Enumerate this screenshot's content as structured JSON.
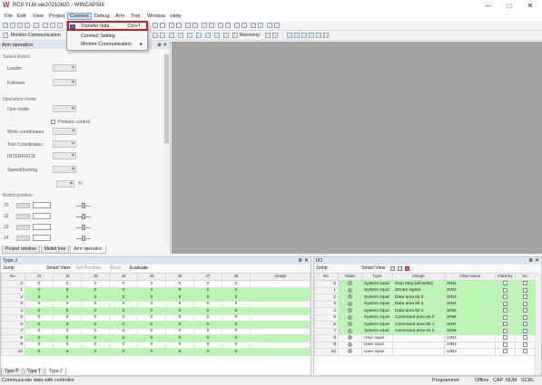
{
  "window": {
    "title": "RC9 YLM ver20210820 - WINCAPSIII",
    "min": "─",
    "max": "□",
    "close": "✕"
  },
  "menu": [
    "File",
    "Edit",
    "View",
    "Project",
    "Connect",
    "Debug",
    "Arm",
    "Tool",
    "Window",
    "Help"
  ],
  "toolbar2": {
    "monitor": "Monitor Communication",
    "recovery": "Recovery"
  },
  "connect_menu": {
    "items": [
      {
        "label": "Transfer data ...",
        "shortcut": "Ctrl+T"
      },
      {
        "label": "Connect Setting",
        "shortcut": ""
      },
      {
        "label": "Monitor Communication",
        "shortcut": ""
      }
    ],
    "submenu_arrow": "▸"
  },
  "arm_panel": {
    "title": "Arm operation",
    "pin": "⊕ ✕",
    "select_robot": "Select Robot",
    "leader": "Leader",
    "follower": "Follower",
    "operation_mode": "Operation mode",
    "ope_mode": "Ope mode",
    "posture_control": "Posture control",
    "work_coordinates": "Work coordinates",
    "tool_coordinates": "Tool Coordinates",
    "speed_label": "INTERP/ECE",
    "speed_inching": "Speed/Inching",
    "percent": "%",
    "robot_position": "Robot position",
    "joints": [
      "J1",
      "J2",
      "J3",
      "J4"
    ]
  },
  "left_tabs": [
    "Project window",
    "Model tree",
    "Arm operation"
  ],
  "typej": {
    "title": "Type J",
    "jump": "Jump",
    "smart_view": "Smart View",
    "get_position": "Get Position",
    "move": "Move",
    "evaluate": "Evaluate",
    "columns": [
      "No.",
      "J1",
      "J2",
      "J3",
      "J4",
      "J5",
      "J6",
      "J7",
      "J8",
      "Usage"
    ],
    "rows": [
      [
        "0",
        "0",
        "0",
        "0",
        "0",
        "0",
        "0",
        "0",
        "0",
        ""
      ],
      [
        "1",
        "0",
        "0",
        "0",
        "0",
        "0",
        "0",
        "0",
        "0",
        ""
      ],
      [
        "2",
        "0",
        "0",
        "0",
        "0",
        "0",
        "0",
        "0",
        "0",
        ""
      ],
      [
        "3",
        "0",
        "0",
        "0",
        "0",
        "0",
        "0",
        "0",
        "0",
        ""
      ],
      [
        "4",
        "0",
        "0",
        "0",
        "0",
        "0",
        "0",
        "0",
        "0",
        ""
      ],
      [
        "5",
        "0",
        "0",
        "0",
        "0",
        "0",
        "0",
        "0",
        "0",
        ""
      ],
      [
        "6",
        "0",
        "0",
        "0",
        "0",
        "0",
        "0",
        "0",
        "0",
        ""
      ],
      [
        "7",
        "0",
        "0",
        "0",
        "0",
        "0",
        "0",
        "0",
        "0",
        ""
      ],
      [
        "8",
        "0",
        "0",
        "0",
        "0",
        "0",
        "0",
        "0",
        "0",
        ""
      ],
      [
        "9",
        "0",
        "0",
        "0",
        "0",
        "0",
        "0",
        "0",
        "0",
        ""
      ],
      [
        "10",
        "0",
        "0",
        "0",
        "0",
        "0",
        "0",
        "0",
        "0",
        ""
      ]
    ],
    "tabs": [
      "Type P",
      "Type T",
      "Type J"
    ]
  },
  "io": {
    "title": "I/O",
    "jump": "Jump",
    "smart_view": "Smart View",
    "columns": [
      "No.",
      "State",
      "Type",
      "Usage",
      "Alias name",
      "Dummy",
      "Inv"
    ],
    "rows": [
      [
        "0",
        "System input",
        "Stop stop (all tasks)",
        "SIN1"
      ],
      [
        "1",
        "System input",
        "Strobe signal",
        "SIN2"
      ],
      [
        "2",
        "System input",
        "Data area bit 0",
        "SIN3"
      ],
      [
        "3",
        "System input",
        "Data area bit 1",
        "SIN4"
      ],
      [
        "4",
        "System input",
        "Data area bit 2",
        "SIN5"
      ],
      [
        "5",
        "System input",
        "Command area bit 0",
        "SIN6"
      ],
      [
        "6",
        "System input",
        "Command area bit 1",
        "SIN7"
      ],
      [
        "7",
        "System input",
        "Command area bit 2",
        "SIN8"
      ],
      [
        "8",
        "User input",
        "",
        "UIN1"
      ],
      [
        "9",
        "User input",
        "",
        "UIN2"
      ],
      [
        "10",
        "User input",
        "",
        "UIN3"
      ]
    ]
  },
  "status": {
    "left": "Communicate data with controller.",
    "user": "Programmer",
    "mode": "Offline",
    "cap": "CAP",
    "num": "NUM",
    "scrl": "SCRL"
  },
  "colors": {
    "highlight": "#d4191f",
    "io_green": "#b8f7b0",
    "workarea": "#a3a3a3"
  }
}
